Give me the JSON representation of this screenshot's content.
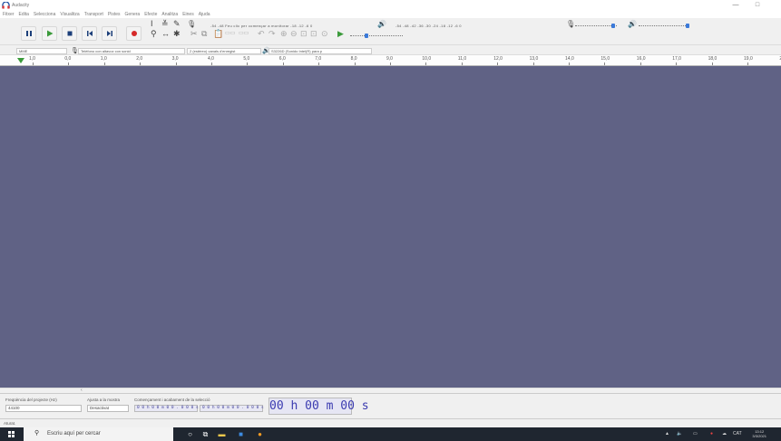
{
  "window": {
    "title": "Audacity",
    "minimize_glyph": "—",
    "maximize_glyph": "□"
  },
  "menu": [
    "Fitxer",
    "Edita",
    "Selecciona",
    "Visualitza",
    "Transport",
    "Pistes",
    "Genera",
    "Efecte",
    "Analitza",
    "Eines",
    "Ajuda"
  ],
  "transport": {
    "icons": [
      "pause-icon",
      "play-icon",
      "stop-icon",
      "skip-start-icon",
      "skip-end-icon",
      "record-icon"
    ],
    "colors": {
      "play": "#3a9a3a",
      "record": "#d62a2a",
      "buttons": "#1c3f7a"
    }
  },
  "meters": {
    "record_scale": "-54    -48    Feu clic per començar a monitorar   -18    -12    -6     0",
    "playback_scale": "-54     -48     -42     -36     -30     -24     -18     -12     -6      0"
  },
  "devices": {
    "host": "MME",
    "recording_device": "Telèfono con altavoz con sonid",
    "channels": "2 (estèreo) canals d'enregist",
    "playback_device": "S3226D (Sonido Intel(R) para p"
  },
  "timeline": {
    "labels": [
      "1,0",
      "0,0",
      "1,0",
      "2,0",
      "3,0",
      "4,0",
      "5,0",
      "6,0",
      "7,0",
      "8,0",
      "9,0",
      "10,0",
      "11,0",
      "12,0",
      "13,0",
      "14,0",
      "15,0",
      "16,0",
      "17,0",
      "18,0",
      "19,0",
      "20,0"
    ]
  },
  "selection": {
    "rate_label": "Freqüència del projecte (Hz)",
    "snap_label": "Ajusta a la mostra",
    "range_label": "Començament i acabament de la selecció",
    "rate_value": "44100",
    "snap_value": "Desactivat",
    "start_time": "0 0 h 0 0 m 0 0 . 0 0 0 s",
    "end_time": "0 0 h 0 0 m 0 0 . 0 0 0 s",
    "audio_position": "00 h 00 m 00 s"
  },
  "status": {
    "text": "Aturat."
  },
  "taskbar": {
    "search_placeholder": "Escriu aquí per cercar",
    "tray_lang": "CAT",
    "time": "13:12",
    "date": "3/3/2021"
  }
}
